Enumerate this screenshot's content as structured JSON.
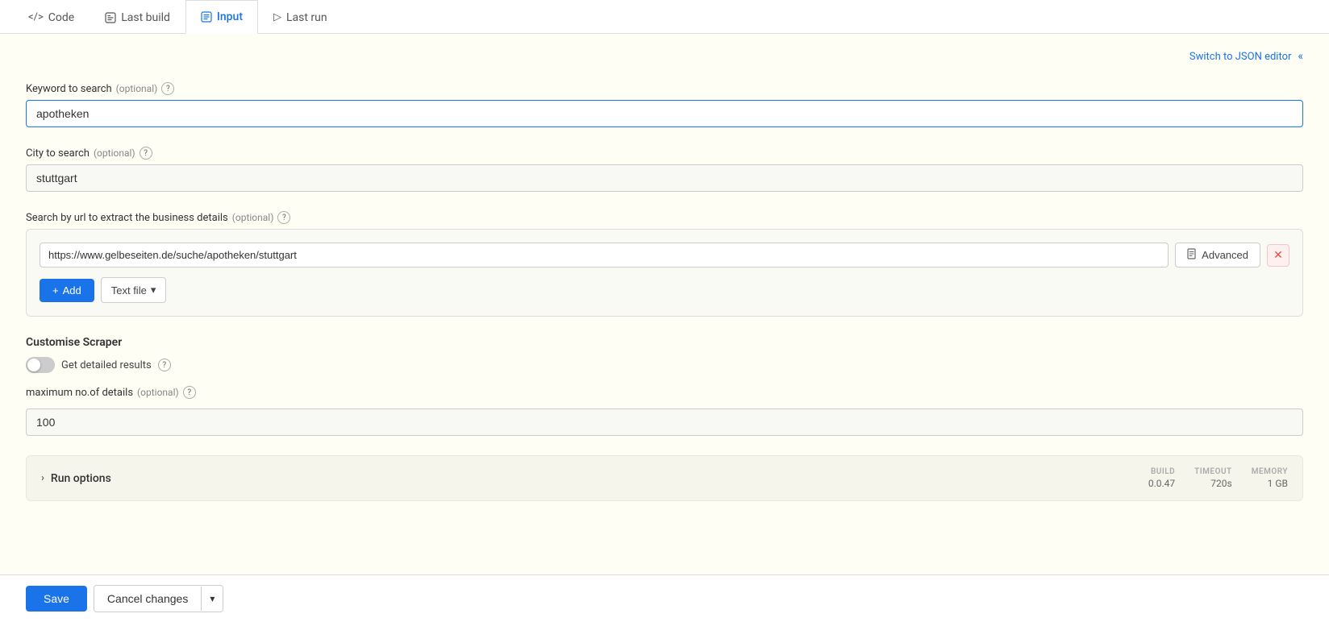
{
  "tabs": [
    {
      "id": "code",
      "label": "Code",
      "icon": "</>",
      "active": false
    },
    {
      "id": "last-build",
      "label": "Last build",
      "icon": "⬡",
      "active": false
    },
    {
      "id": "input",
      "label": "Input",
      "icon": "📄",
      "active": true
    },
    {
      "id": "last-run",
      "label": "Last run",
      "icon": "▷",
      "active": false
    }
  ],
  "topActions": {
    "switchToJson": "Switch to JSON editor",
    "collapseIcon": "«"
  },
  "fields": {
    "keywordLabel": "Keyword to search",
    "keywordOptional": "(optional)",
    "keywordValue": "apotheken",
    "cityLabel": "City to search",
    "cityOptional": "(optional)",
    "cityValue": "stuttgart",
    "urlLabel": "Search by url to extract the business details",
    "urlOptional": "(optional)",
    "urlValue": "https://www.gelbeseiten.de/suche/apotheken/stuttgart",
    "advancedBtn": "Advanced",
    "addBtn": "+ Add",
    "textFileBtn": "Text file",
    "customiseScraper": "Customise Scraper",
    "getDetailedResults": "Get detailed results",
    "maxDetailsLabel": "maximum no.of details",
    "maxDetailsOptional": "(optional)",
    "maxDetailsValue": "100"
  },
  "runOptions": {
    "label": "Run options",
    "build": {
      "label": "BUILD",
      "value": "0.0.47"
    },
    "timeout": {
      "label": "TIMEOUT",
      "value": "720s"
    },
    "memory": {
      "label": "MEMORY",
      "value": "1 GB"
    }
  },
  "bottomBar": {
    "saveLabel": "Save",
    "cancelLabel": "Cancel changes",
    "dropdownIcon": "▾"
  }
}
